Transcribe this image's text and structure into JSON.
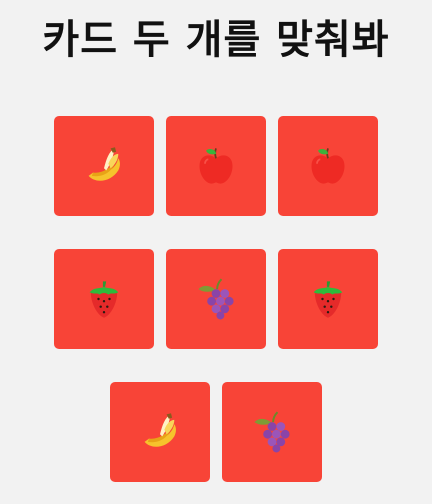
{
  "title": "카드 두 개를 맞춰봐",
  "colors": {
    "background": "#f2f2f2",
    "card": "#f84437"
  },
  "cards": [
    {
      "row": 0,
      "fruit": "banana"
    },
    {
      "row": 0,
      "fruit": "apple"
    },
    {
      "row": 0,
      "fruit": "apple"
    },
    {
      "row": 1,
      "fruit": "strawberry"
    },
    {
      "row": 1,
      "fruit": "grapes"
    },
    {
      "row": 1,
      "fruit": "strawberry"
    },
    {
      "row": 2,
      "fruit": "banana"
    },
    {
      "row": 2,
      "fruit": "grapes"
    }
  ]
}
